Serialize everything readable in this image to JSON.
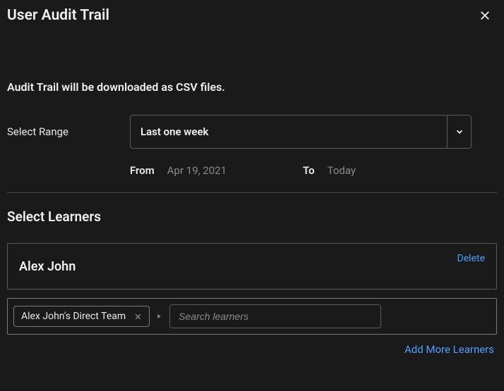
{
  "header": {
    "title": "User Audit Trail"
  },
  "subtitle": "Audit Trail will be downloaded as CSV files.",
  "range": {
    "label": "Select Range",
    "value": "Last one week",
    "from_label": "From",
    "from_value": "Apr 19, 2021",
    "to_label": "To",
    "to_value": "Today"
  },
  "learners": {
    "section_title": "Select Learners",
    "delete_label": "Delete",
    "items": [
      {
        "name": "Alex John"
      }
    ],
    "chip": {
      "label": "Alex John's Direct Team"
    },
    "search_placeholder": "Search learners",
    "add_more_label": "Add More Learners"
  }
}
